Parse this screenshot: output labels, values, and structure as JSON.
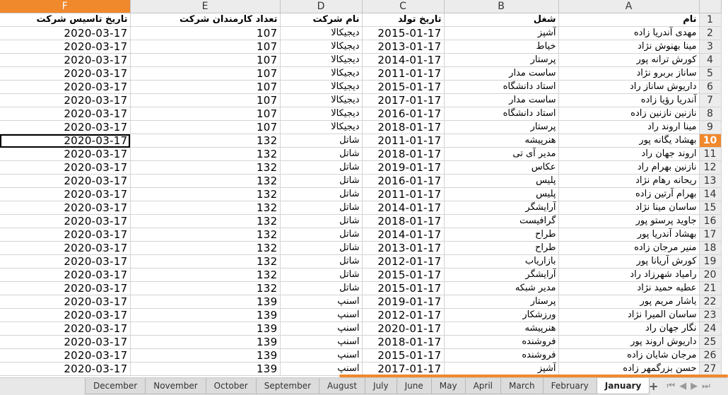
{
  "columns": [
    {
      "letter": "F",
      "active": true
    },
    {
      "letter": "E",
      "active": false
    },
    {
      "letter": "D",
      "active": false
    },
    {
      "letter": "C",
      "active": false
    },
    {
      "letter": "B",
      "active": false
    },
    {
      "letter": "A",
      "active": false
    }
  ],
  "active_row": 10,
  "header_row": {
    "num": "1",
    "F": "تاریخ تاسیس شرکت",
    "E": "تعداد کارمندان شرکت",
    "D": "نام شرکت",
    "C": "تاریخ تولد",
    "B": "شغل",
    "A": "نام"
  },
  "rows": [
    {
      "num": "2",
      "F": "2020-03-17",
      "E": "107",
      "D": "دیجیکالا",
      "C": "2015-01-17",
      "B": "آشپز",
      "A": "مهدی آندریا زاده"
    },
    {
      "num": "3",
      "F": "2020-03-17",
      "E": "107",
      "D": "دیجیکالا",
      "C": "2013-01-17",
      "B": "خیاط",
      "A": "مینا بهنوش نژاد"
    },
    {
      "num": "4",
      "F": "2020-03-17",
      "E": "107",
      "D": "دیجیکالا",
      "C": "2014-01-17",
      "B": "پرستار",
      "A": "کورش ترانه پور"
    },
    {
      "num": "5",
      "F": "2020-03-17",
      "E": "107",
      "D": "دیجیکالا",
      "C": "2011-01-17",
      "B": "ساست مدار",
      "A": "ساناز بربرو نژاد"
    },
    {
      "num": "6",
      "F": "2020-03-17",
      "E": "107",
      "D": "دیجیکالا",
      "C": "2015-01-17",
      "B": "استاد دانشگاه",
      "A": "داریوش ساناز راد"
    },
    {
      "num": "7",
      "F": "2020-03-17",
      "E": "107",
      "D": "دیجیکالا",
      "C": "2017-01-17",
      "B": "ساست مدار",
      "A": "آندریا رؤیا زاده"
    },
    {
      "num": "8",
      "F": "2020-03-17",
      "E": "107",
      "D": "دیجیکالا",
      "C": "2016-01-17",
      "B": "استاد دانشگاه",
      "A": "نازنین نازنین زاده"
    },
    {
      "num": "9",
      "F": "2020-03-17",
      "E": "107",
      "D": "دیجیکالا",
      "C": "2018-01-17",
      "B": "پرستار",
      "A": "مینا اروند راد"
    },
    {
      "num": "10",
      "F": "2020-03-17",
      "E": "132",
      "D": "شاتل",
      "C": "2011-01-17",
      "B": "هنرپیشه",
      "A": "بهشاد یگانه پور"
    },
    {
      "num": "11",
      "F": "2020-03-17",
      "E": "132",
      "D": "شاتل",
      "C": "2018-01-17",
      "B": "مدیر آی تی",
      "A": "اروند جهان راد"
    },
    {
      "num": "12",
      "F": "2020-03-17",
      "E": "132",
      "D": "شاتل",
      "C": "2019-01-17",
      "B": "عکاس",
      "A": "نازنین بهرام راد"
    },
    {
      "num": "13",
      "F": "2020-03-17",
      "E": "132",
      "D": "شاتل",
      "C": "2016-01-17",
      "B": "پلیس",
      "A": "ریحانه رهام نژاد"
    },
    {
      "num": "14",
      "F": "2020-03-17",
      "E": "132",
      "D": "شاتل",
      "C": "2011-01-17",
      "B": "پلیس",
      "A": "بهرام آرتین زاده"
    },
    {
      "num": "15",
      "F": "2020-03-17",
      "E": "132",
      "D": "شاتل",
      "C": "2014-01-17",
      "B": "آرایشگر",
      "A": "ساسان مینا نژاد"
    },
    {
      "num": "16",
      "F": "2020-03-17",
      "E": "132",
      "D": "شاتل",
      "C": "2018-01-17",
      "B": "گرافیست",
      "A": "جاوید پرستو پور"
    },
    {
      "num": "17",
      "F": "2020-03-17",
      "E": "132",
      "D": "شاتل",
      "C": "2014-01-17",
      "B": "طراح",
      "A": "بهشاد آندریا پور"
    },
    {
      "num": "18",
      "F": "2020-03-17",
      "E": "132",
      "D": "شاتل",
      "C": "2013-01-17",
      "B": "طراح",
      "A": "منیر مرجان زاده"
    },
    {
      "num": "19",
      "F": "2020-03-17",
      "E": "132",
      "D": "شاتل",
      "C": "2012-01-17",
      "B": "بازاریاب",
      "A": "کورش آریانا پور"
    },
    {
      "num": "20",
      "F": "2020-03-17",
      "E": "132",
      "D": "شاتل",
      "C": "2015-01-17",
      "B": "آرایشگر",
      "A": "رامیاد شهرزاد راد"
    },
    {
      "num": "21",
      "F": "2020-03-17",
      "E": "132",
      "D": "شاتل",
      "C": "2015-01-17",
      "B": "مدیر شبکه",
      "A": "عطیه حمید نژاد"
    },
    {
      "num": "22",
      "F": "2020-03-17",
      "E": "139",
      "D": "اسنپ",
      "C": "2019-01-17",
      "B": "پرستار",
      "A": "یاشار مریم پور"
    },
    {
      "num": "23",
      "F": "2020-03-17",
      "E": "139",
      "D": "اسنپ",
      "C": "2012-01-17",
      "B": "ورزشکار",
      "A": "ساسان المیرا نژاد"
    },
    {
      "num": "24",
      "F": "2020-03-17",
      "E": "139",
      "D": "اسنپ",
      "C": "2020-01-17",
      "B": "هنرپیشه",
      "A": "نگار جهان راد"
    },
    {
      "num": "25",
      "F": "2020-03-17",
      "E": "139",
      "D": "اسنپ",
      "C": "2018-01-17",
      "B": "فروشنده",
      "A": "داریوش اروند پور"
    },
    {
      "num": "26",
      "F": "2020-03-17",
      "E": "139",
      "D": "اسنپ",
      "C": "2015-01-17",
      "B": "فروشنده",
      "A": "مرجان شایان زاده"
    },
    {
      "num": "27",
      "F": "2020-03-17",
      "E": "139",
      "D": "اسنپ",
      "C": "2017-01-17",
      "B": "آشپز",
      "A": "حسن بزرگمهر زاده"
    }
  ],
  "sheet_tabs": [
    "December",
    "November",
    "October",
    "September",
    "August",
    "July",
    "June",
    "May",
    "April",
    "March",
    "February",
    "January"
  ],
  "active_tab": "January",
  "icons": {
    "add_sheet": "+",
    "first": "⏮",
    "prev": "◀",
    "next": "▶",
    "last": "⏭"
  },
  "colors": {
    "accent": "#f0882c"
  }
}
